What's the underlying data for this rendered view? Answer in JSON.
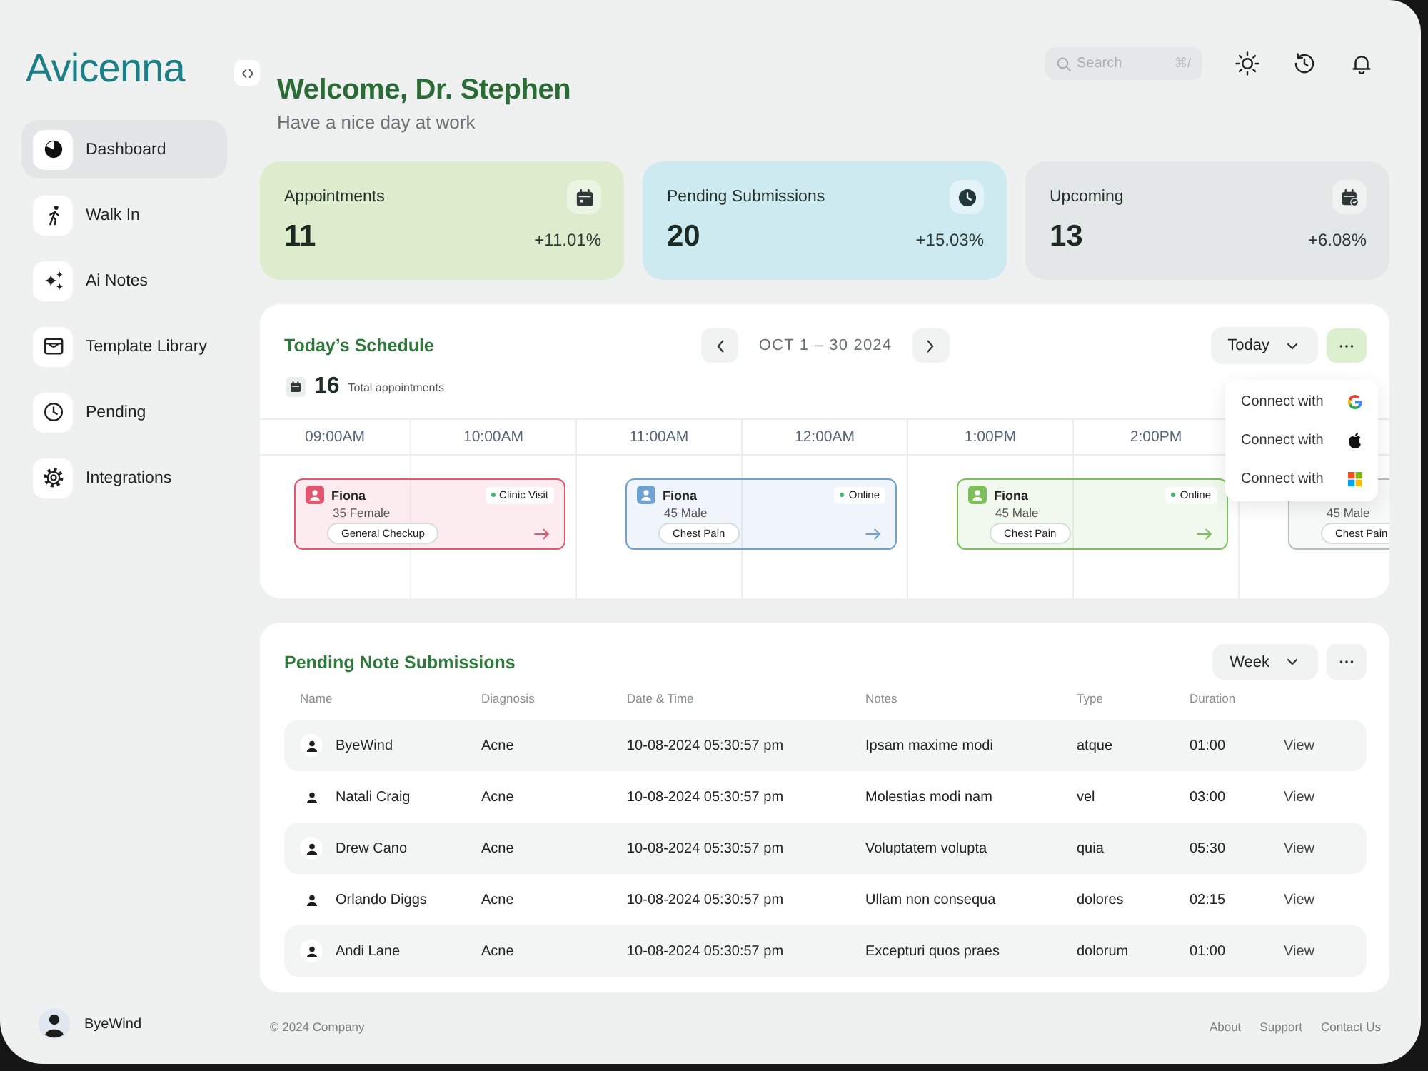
{
  "sidebar": {
    "logo": "Avicenna",
    "items": [
      {
        "label": "Dashboard",
        "selected": true
      },
      {
        "label": "Walk In",
        "selected": false
      },
      {
        "label": "Ai Notes",
        "selected": false
      },
      {
        "label": "Template Library",
        "selected": false
      },
      {
        "label": "Pending",
        "selected": false
      },
      {
        "label": "Integrations",
        "selected": false
      }
    ],
    "user": {
      "name": "ByeWind"
    }
  },
  "header": {
    "title": "Welcome, Dr. Stephen",
    "subtitle": "Have a nice day at work",
    "search": {
      "placeholder": "Search",
      "shortcut": "⌘/"
    }
  },
  "stats": [
    {
      "title": "Appointments",
      "value": "11",
      "change": "+11.01%",
      "color": "#ddeccc"
    },
    {
      "title": "Pending Submissions",
      "value": "20",
      "change": "+15.03%",
      "color": "#cdeaf1"
    },
    {
      "title": "Upcoming",
      "value": "13",
      "change": "+6.08%",
      "color": "#e4e7e7"
    }
  ],
  "schedule": {
    "title": "Today’s Schedule",
    "range": "OCT 1 – 30 2024",
    "filter": "Today",
    "total": "16",
    "total_label": "Total appointments",
    "times": [
      "09:00AM",
      "10:00AM",
      "11:00AM",
      "12:00AM",
      "1:00PM",
      "2:00PM"
    ],
    "appointments": [
      {
        "name": "Fiona",
        "mode": "Clinic Visit",
        "details": "35 Female",
        "reason": "General Checkup",
        "color": "#e2566f"
      },
      {
        "name": "Fiona",
        "mode": "Online",
        "details": "45 Male",
        "reason": "Chest Pain",
        "color": "#6fa2d2"
      },
      {
        "name": "Fiona",
        "mode": "Online",
        "details": "45 Male",
        "reason": "Chest Pain",
        "color": "#7dbf5b"
      },
      {
        "details": "45 Male",
        "reason": "Chest Pain",
        "color": "#b5bfbf"
      }
    ],
    "menu": [
      {
        "label": "Connect with"
      },
      {
        "label": "Connect with"
      },
      {
        "label": "Connect with"
      }
    ]
  },
  "notes_table": {
    "title": "Pending Note Submissions",
    "filter": "Week",
    "columns": [
      "Name",
      "Diagnosis",
      "Date & Time",
      "Notes",
      "Type",
      "Duration"
    ],
    "rows": [
      [
        "ByeWind",
        "Acne",
        "10-08-2024 05:30:57 pm",
        "Ipsam maxime modi",
        "atque",
        "01:00",
        "View"
      ],
      [
        "Natali Craig",
        "Acne",
        "10-08-2024 05:30:57 pm",
        "Molestias modi nam",
        "vel",
        "03:00",
        "View"
      ],
      [
        "Drew Cano",
        "Acne",
        "10-08-2024 05:30:57 pm",
        "Voluptatem volupta",
        "quia",
        "05:30",
        "View"
      ],
      [
        "Orlando Diggs",
        "Acne",
        "10-08-2024 05:30:57 pm",
        "Ullam non consequa",
        "dolores",
        "02:15",
        "View"
      ],
      [
        "Andi Lane",
        "Acne",
        "10-08-2024 05:30:57 pm",
        "Excepturi quos praes",
        "dolorum",
        "01:00",
        "View"
      ]
    ]
  },
  "footer": {
    "copyright": "© 2024 Company",
    "links": [
      "About",
      "Support",
      "Contact Us"
    ]
  }
}
